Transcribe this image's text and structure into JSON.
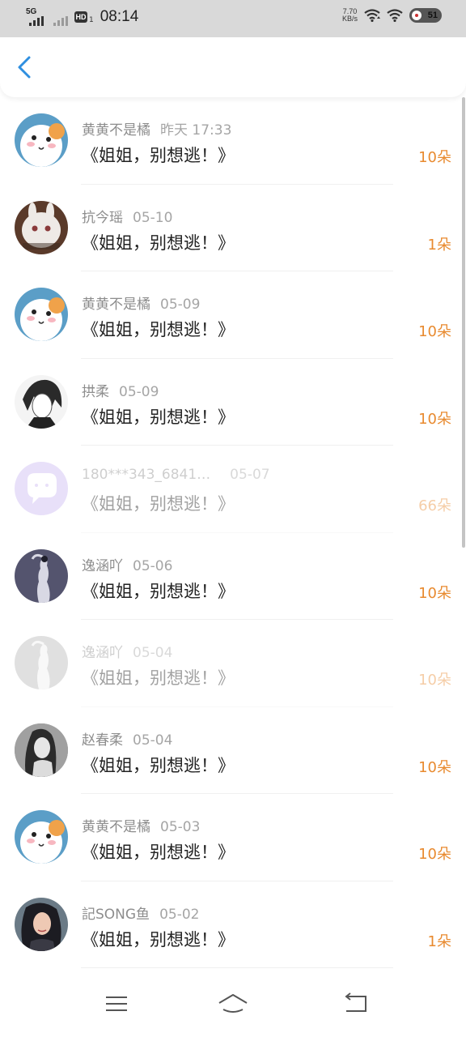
{
  "status_bar": {
    "network": "5G",
    "hd": "HD",
    "hd_sub": "1",
    "time": "08:14",
    "speed_value": "7.70",
    "speed_unit": "KB/s",
    "battery": "51"
  },
  "header": {
    "back_icon": "chevron-left-icon"
  },
  "list": [
    {
      "user": "黄黄不是橘",
      "date": "昨天 17:33",
      "title": "《姐姐，别想逃！》",
      "flowers": "10朵",
      "avatar": "hamster"
    },
    {
      "user": "抗今瑶",
      "date": "05-10",
      "title": "《姐姐，别想逃！》",
      "flowers": "1朵",
      "avatar": "white-rabbit"
    },
    {
      "user": "黄黄不是橘",
      "date": "05-09",
      "title": "《姐姐，别想逃！》",
      "flowers": "10朵",
      "avatar": "hamster"
    },
    {
      "user": "拱柔",
      "date": "05-09",
      "title": "《姐姐，别想逃！》",
      "flowers": "10朵",
      "avatar": "anime-sketch"
    },
    {
      "user": "180***343_6841…",
      "date": "05-07",
      "title": "《姐姐，别想逃！》",
      "flowers": "66朵",
      "avatar": "default-chat",
      "faded": true
    },
    {
      "user": "逸涵吖",
      "date": "05-06",
      "title": "《姐姐，别想逃！》",
      "flowers": "10朵",
      "avatar": "dancer"
    },
    {
      "user": "逸涵吖",
      "date": "05-04",
      "title": "《姐姐，别想逃！》",
      "flowers": "10朵",
      "avatar": "dancer-gray",
      "faded": true
    },
    {
      "user": "赵春柔",
      "date": "05-04",
      "title": "《姐姐，别想逃！》",
      "flowers": "10朵",
      "avatar": "portrait-bw"
    },
    {
      "user": "黄黄不是橘",
      "date": "05-03",
      "title": "《姐姐，别想逃！》",
      "flowers": "10朵",
      "avatar": "hamster"
    },
    {
      "user": "記SONG鱼",
      "date": "05-02",
      "title": "《姐姐，别想逃！》",
      "flowers": "1朵",
      "avatar": "portrait-color"
    }
  ],
  "colors": {
    "flower_count": "#e88a2f",
    "back_icon": "#2f8fe0"
  },
  "nav": {
    "menu_icon": "menu-icon",
    "home_icon": "home-icon",
    "back_icon": "back-icon"
  }
}
